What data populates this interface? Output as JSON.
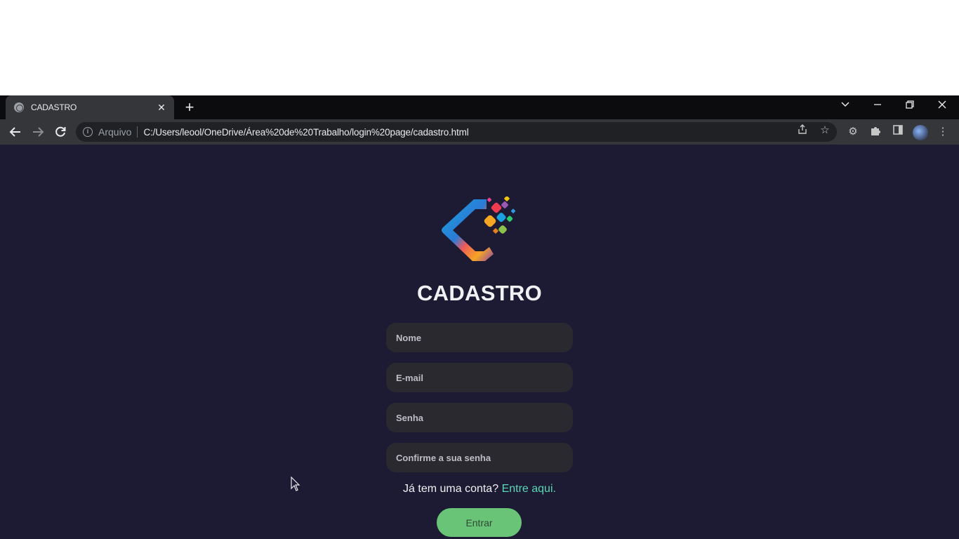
{
  "browser": {
    "tab_title": "CADASTRO",
    "address_scheme_label": "Arquivo",
    "url": "C:/Users/leool/OneDrive/Área%20de%20Trabalho/login%20page/cadastro.html"
  },
  "page": {
    "title": "CADASTRO",
    "fields": {
      "name_placeholder": "Nome",
      "email_placeholder": "E-mail",
      "password_placeholder": "Senha",
      "confirm_placeholder": "Confirme a sua senha"
    },
    "login_prompt": "Já tem uma conta?",
    "login_link": "Entre aqui.",
    "submit_label": "Entrar"
  },
  "colors": {
    "background": "#1c1b33",
    "input_bg": "#2a2930",
    "link": "#5ad7b5",
    "button": "#6ac478"
  }
}
